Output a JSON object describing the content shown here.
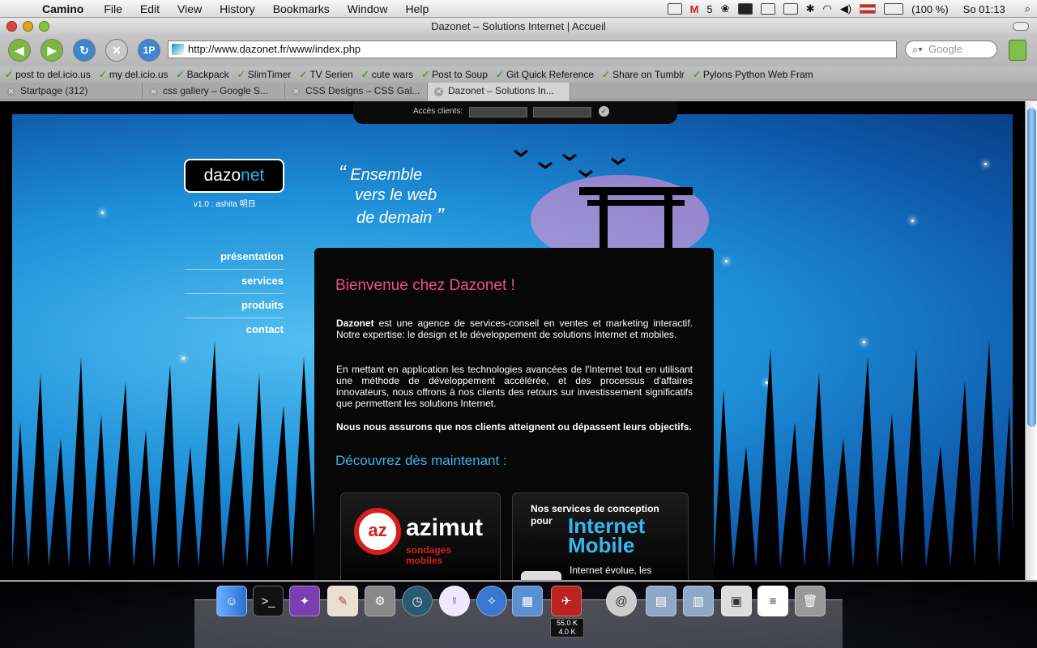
{
  "menubar": {
    "app": "Camino",
    "items": [
      "File",
      "Edit",
      "View",
      "History",
      "Bookmarks",
      "Window",
      "Help"
    ],
    "mail_count": "5",
    "battery": "(100 %)",
    "clock": "So 01:13"
  },
  "window": {
    "title": "Dazonet – Solutions Internet | Accueil",
    "url": "http://www.dazonet.fr/www/index.php",
    "search_placeholder": "Google",
    "nav_labels": {
      "onepassword": "1P"
    }
  },
  "bookmarks": [
    "post to del.icio.us",
    "my del.icio.us",
    "Backpack",
    "SlimTimer",
    "TV Serien",
    "cute wars",
    "Post to Soup",
    "Git Quick Reference",
    "Share on Tumblr",
    "Pylons Python Web Fram"
  ],
  "tabs": [
    {
      "label": "Startpage (312)",
      "active": false
    },
    {
      "label": "css gallery – Google S...",
      "active": false
    },
    {
      "label": "CSS Designs – CSS Gal...",
      "active": false
    },
    {
      "label": "Dazonet – Solutions In...",
      "active": true
    }
  ],
  "page": {
    "access_label": "Accès clients:",
    "logo_left": "dazo",
    "logo_right": "net",
    "version": "v1.0 : ashita 明日",
    "slogan": [
      "Ensemble",
      "vers le web",
      "de demain"
    ],
    "nav": [
      "présentation",
      "services",
      "produits",
      "contact"
    ],
    "welcome": "Bienvenue chez Dazonet !",
    "para1_strong": "Dazonet",
    "para1": " est une agence de services-conseil en ventes et marketing interactif. Notre expertise: le design et le développement de solutions Internet et mobiles.",
    "para2": "En mettant en application les technologies avancées de l'Internet tout en utilisant une méthode de développement accélérée, et des processus d'affaires innovateurs, nous offrons à nos clients des retours sur investissement significatifs que permettent les solutions Internet.",
    "para3": "Nous nous assurons que nos clients atteignent ou dépassent leurs objectifs.",
    "discover": "Découvrez dès maintenant :",
    "azimut": {
      "mark": "az",
      "word": "azimut",
      "tag": "sondages mobiles"
    },
    "services_card": {
      "title": "Nos services de conception pour",
      "big": "Internet Mobile",
      "text": "Internet évolue, les"
    }
  },
  "dock": {
    "net_up": "55.0 K",
    "net_down": "4.0 K"
  },
  "colors": {
    "accent_pink": "#f24a98",
    "accent_blue": "#3ab3ea",
    "brand_red": "#d61e1e"
  }
}
